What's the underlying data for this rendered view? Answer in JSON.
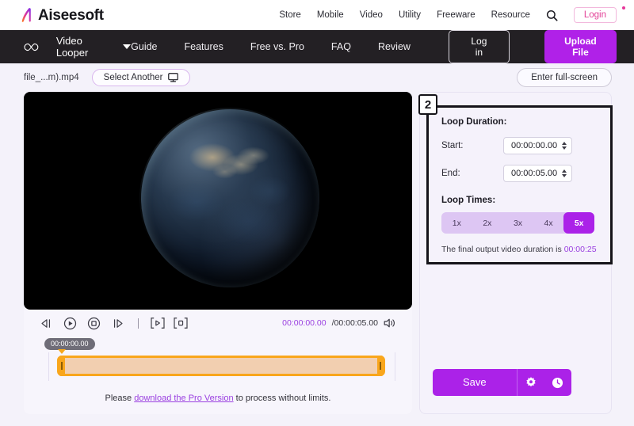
{
  "brand": {
    "name": "Aiseesoft",
    "accent": "#b021e8",
    "logo_gradient_from": "#ff7a18",
    "logo_gradient_to": "#8b2ff0"
  },
  "topbar": {
    "nav": [
      {
        "label": "Store"
      },
      {
        "label": "Mobile"
      },
      {
        "label": "Video"
      },
      {
        "label": "Utility"
      },
      {
        "label": "Freeware"
      },
      {
        "label": "Resource"
      }
    ],
    "search_icon": "search-icon",
    "login_label": "Login"
  },
  "darkbar": {
    "brand_icon": "infinity-icon",
    "product": "Video Looper",
    "nav": [
      {
        "label": "Guide"
      },
      {
        "label": "Features"
      },
      {
        "label": "Free vs. Pro"
      },
      {
        "label": "FAQ"
      },
      {
        "label": "Review"
      }
    ],
    "login_label": "Log in",
    "upload_label": "Upload File"
  },
  "filerow": {
    "filename": "file_...m).mp4",
    "select_another_label": "Select Another",
    "select_another_icon": "monitor-icon",
    "fullscreen_label": "Enter full-screen"
  },
  "player": {
    "controls": [
      {
        "name": "rewind-icon"
      },
      {
        "name": "play-circle-icon"
      },
      {
        "name": "stop-circle-icon"
      },
      {
        "name": "fast-forward-icon"
      }
    ],
    "bracket_controls": [
      {
        "name": "mark-in-icon"
      },
      {
        "name": "mark-out-icon"
      }
    ],
    "current_time": "00:00:00.00",
    "total_time": "/00:00:05.00",
    "volume_icon": "volume-icon",
    "timeline_tooltip": "00:00:00.00"
  },
  "pro_note": {
    "before": "Please ",
    "link": "download the Pro Version",
    "after": " to process without limits."
  },
  "loop_panel": {
    "badge": "2",
    "section_title": "Loop Duration:",
    "start_label": "Start:",
    "start_value": "00:00:00.00",
    "end_label": "End:",
    "end_value": "00:00:05.00",
    "loop_times_title": "Loop Times:",
    "loop_options": [
      {
        "label": "1x",
        "selected": false
      },
      {
        "label": "2x",
        "selected": false
      },
      {
        "label": "3x",
        "selected": false
      },
      {
        "label": "4x",
        "selected": false
      },
      {
        "label": "5x",
        "selected": true
      }
    ],
    "final_note_text": "The final output video duration is ",
    "final_note_value": "00:00:25"
  },
  "actions": {
    "save_label": "Save",
    "settings_icon": "gear-icon",
    "history_icon": "clock-icon"
  }
}
